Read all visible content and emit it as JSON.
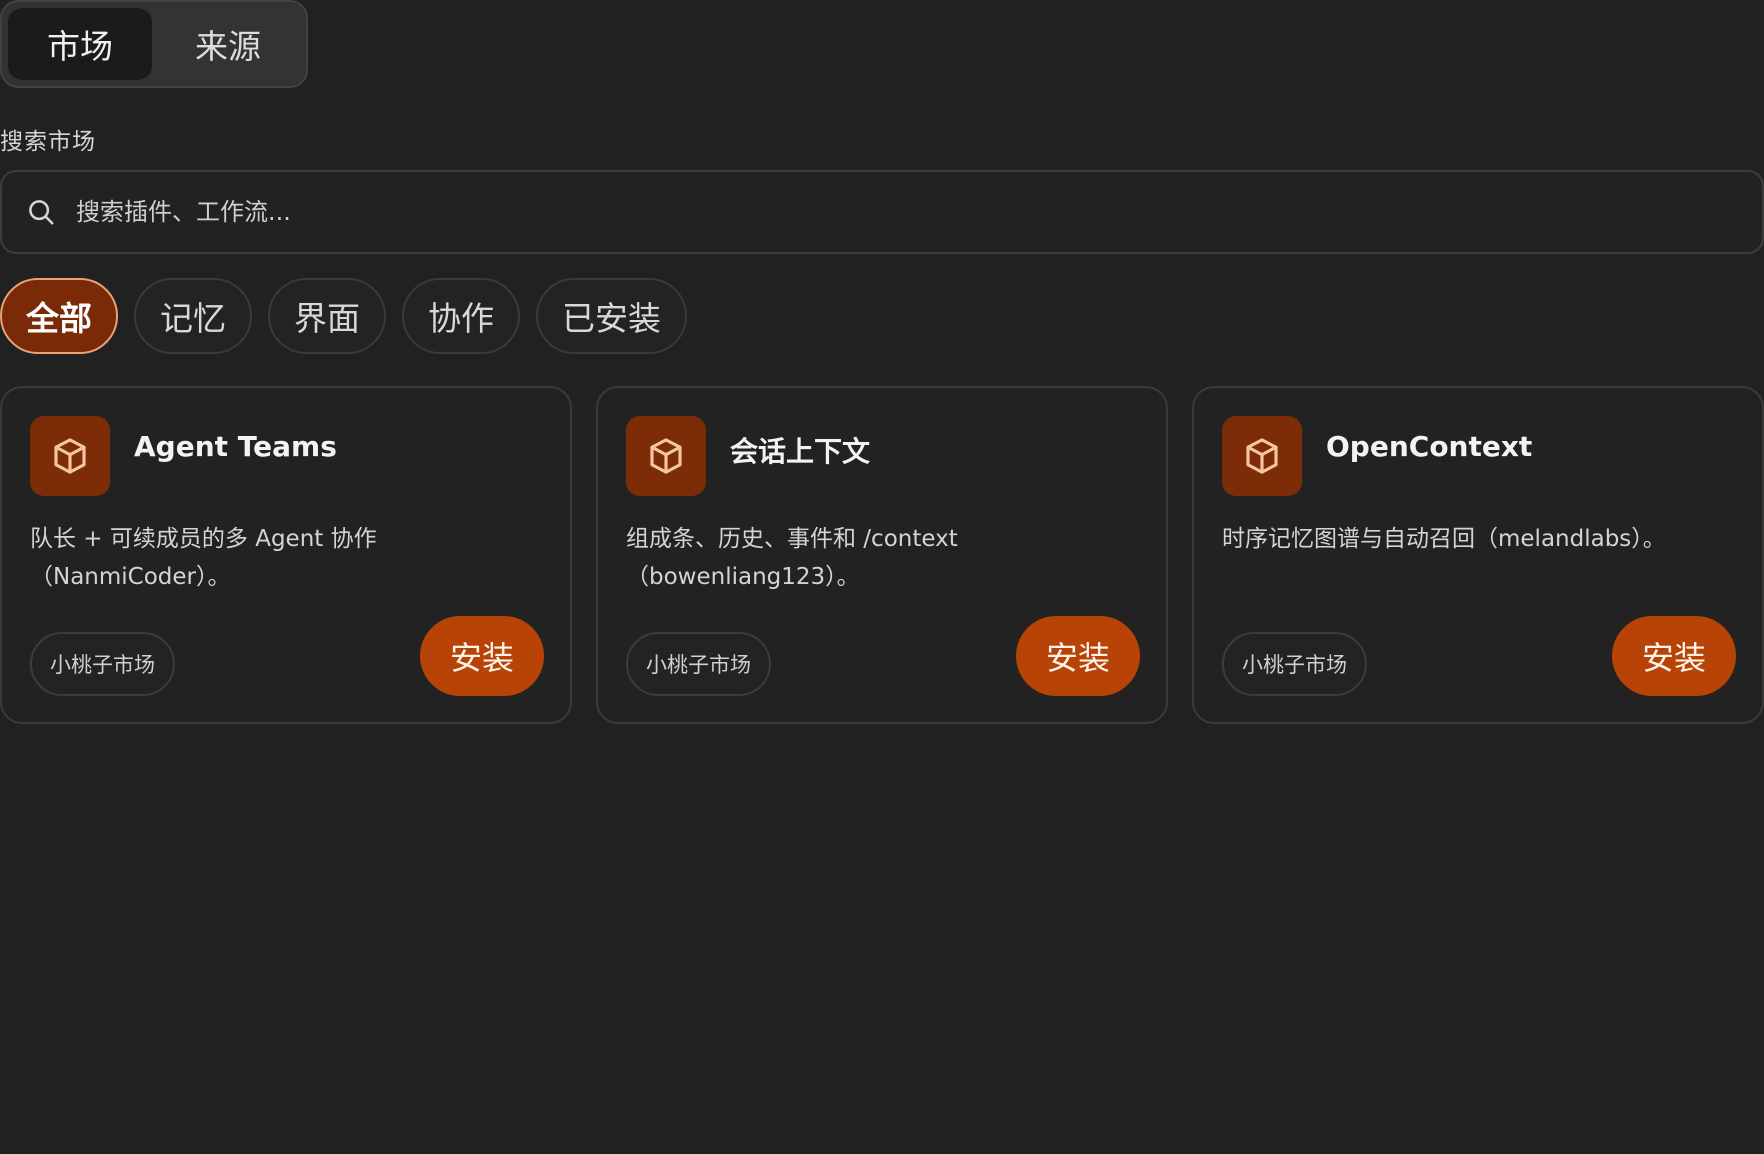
{
  "top_tabs": [
    {
      "label": "市场",
      "active": true
    },
    {
      "label": "来源",
      "active": false
    }
  ],
  "search": {
    "label": "搜索市场",
    "placeholder": "搜索插件、工作流..."
  },
  "filters": [
    {
      "label": "全部",
      "active": true
    },
    {
      "label": "记忆",
      "active": false
    },
    {
      "label": "界面",
      "active": false
    },
    {
      "label": "协作",
      "active": false
    },
    {
      "label": "已安装",
      "active": false
    }
  ],
  "cards": [
    {
      "title": "Agent Teams",
      "description": "队长 + 可续成员的多 Agent 协作（NanmiCoder）。",
      "tag": "小桃子市场",
      "install_label": "安装"
    },
    {
      "title": "会话上下文",
      "description": "组成条、历史、事件和 /context（bowenliang123）。",
      "tag": "小桃子市场",
      "install_label": "安装"
    },
    {
      "title": "OpenContext",
      "description": "时序记忆图谱与自动召回（melandlabs）。",
      "tag": "小桃子市场",
      "install_label": "安装"
    }
  ],
  "colors": {
    "background": "#212121",
    "accent": "#b84307",
    "accent_dark": "#7c2c06",
    "active_pill_border": "#e8a277"
  },
  "icons": {
    "search": "search-icon",
    "card": "package-cube-icon"
  }
}
